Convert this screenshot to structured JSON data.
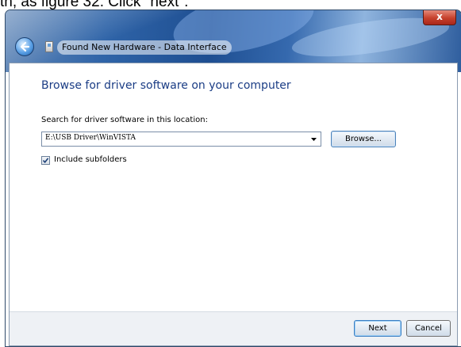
{
  "caption": "th, as figure 32. Click \"next\".",
  "window": {
    "title": "Found New Hardware - Data Interface",
    "close_label": "x"
  },
  "main": {
    "heading": "Browse for driver software on your computer",
    "search_label": "Search for driver software in this location:",
    "path_value": "E:\\USB Driver\\WinVISTA",
    "browse_label": "Browse...",
    "include_subfolders_label": "Include subfolders",
    "include_subfolders_checked": true
  },
  "footer": {
    "next_label": "Next",
    "cancel_label": "Cancel"
  }
}
